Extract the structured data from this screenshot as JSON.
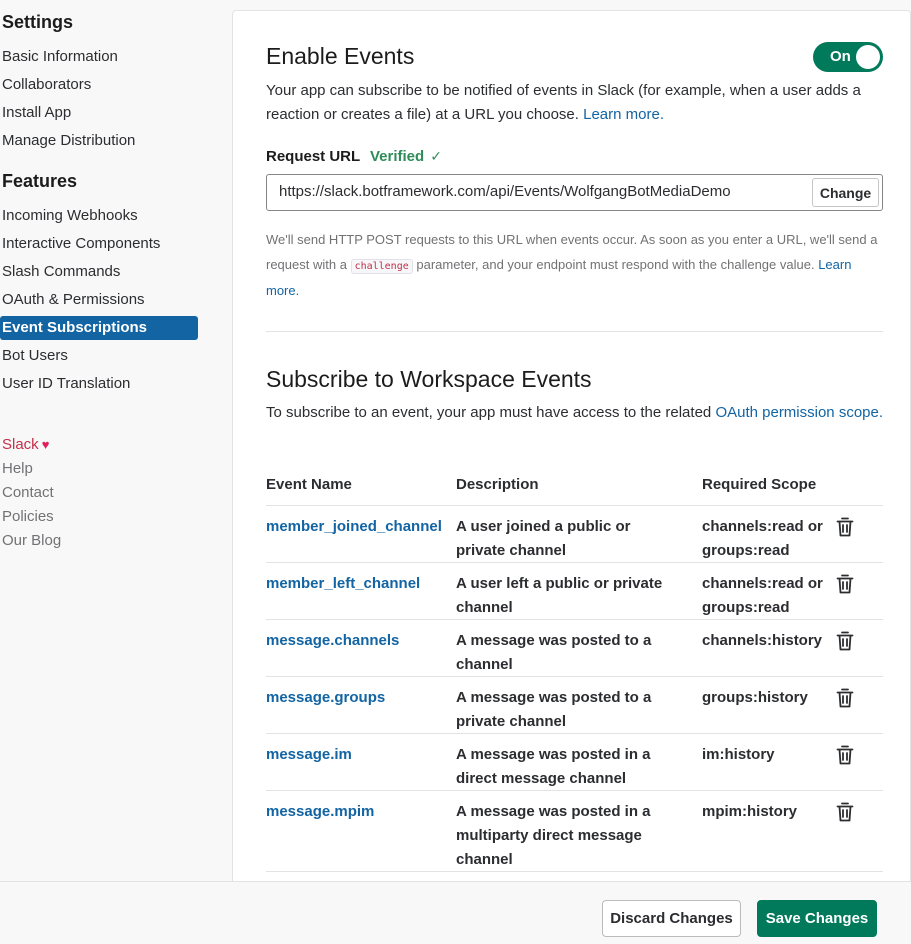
{
  "sidebar": {
    "settings_heading": "Settings",
    "settings_items": [
      {
        "label": "Basic Information"
      },
      {
        "label": "Collaborators"
      },
      {
        "label": "Install App"
      },
      {
        "label": "Manage Distribution"
      }
    ],
    "features_heading": "Features",
    "features_items": [
      {
        "label": "Incoming Webhooks"
      },
      {
        "label": "Interactive Components"
      },
      {
        "label": "Slash Commands"
      },
      {
        "label": "OAuth & Permissions"
      },
      {
        "label": "Event Subscriptions",
        "active": true
      },
      {
        "label": "Bot Users"
      },
      {
        "label": "User ID Translation"
      }
    ],
    "links": [
      {
        "label": "Slack"
      },
      {
        "label": "Help"
      },
      {
        "label": "Contact"
      },
      {
        "label": "Policies"
      },
      {
        "label": "Our Blog"
      }
    ]
  },
  "enable_events": {
    "title": "Enable Events",
    "toggle_label": "On",
    "description": "Your app can subscribe to be notified of events in Slack (for example, when a user adds a reaction or creates a file) at a URL you choose.",
    "learn_more": "Learn more.",
    "request_url_label": "Request URL",
    "verified_label": "Verified",
    "request_url": "https://slack.botframework.com/api/Events/WolfgangBotMediaDemo",
    "change_button": "Change",
    "help_part1": "We'll send HTTP POST requests to this URL when events occur. As soon as you enter a URL, we'll send a request with a",
    "help_code": "challenge",
    "help_part2": "parameter, and your endpoint must respond with the challenge value.",
    "help_learn_more": "Learn more."
  },
  "workspace_events": {
    "title": "Subscribe to Workspace Events",
    "description": "To subscribe to an event, your app must have access to the related",
    "description_link": "OAuth permission scope.",
    "columns": {
      "name": "Event Name",
      "description": "Description",
      "scope": "Required Scope"
    },
    "rows": [
      {
        "name": "member_joined_channel",
        "description": "A user joined a public or private channel",
        "scope": "channels:read or groups:read"
      },
      {
        "name": "member_left_channel",
        "description": "A user left a public or private channel",
        "scope": "channels:read or groups:read"
      },
      {
        "name": "message.channels",
        "description": "A message was posted to a channel",
        "scope": "channels:history"
      },
      {
        "name": "message.groups",
        "description": "A message was posted to a private channel",
        "scope": "groups:history"
      },
      {
        "name": "message.im",
        "description": "A message was posted in a direct message channel",
        "scope": "im:history"
      },
      {
        "name": "message.mpim",
        "description": "A message was posted in a multiparty direct message channel",
        "scope": "mpim:history"
      }
    ]
  },
  "footer": {
    "discard_button": "Discard Changes",
    "save_button": "Save Changes"
  },
  "colors": {
    "accent_green": "#007a5a",
    "link_blue": "#1264a3",
    "active_nav": "#1264a3",
    "verified_green": "#2f8c59"
  }
}
